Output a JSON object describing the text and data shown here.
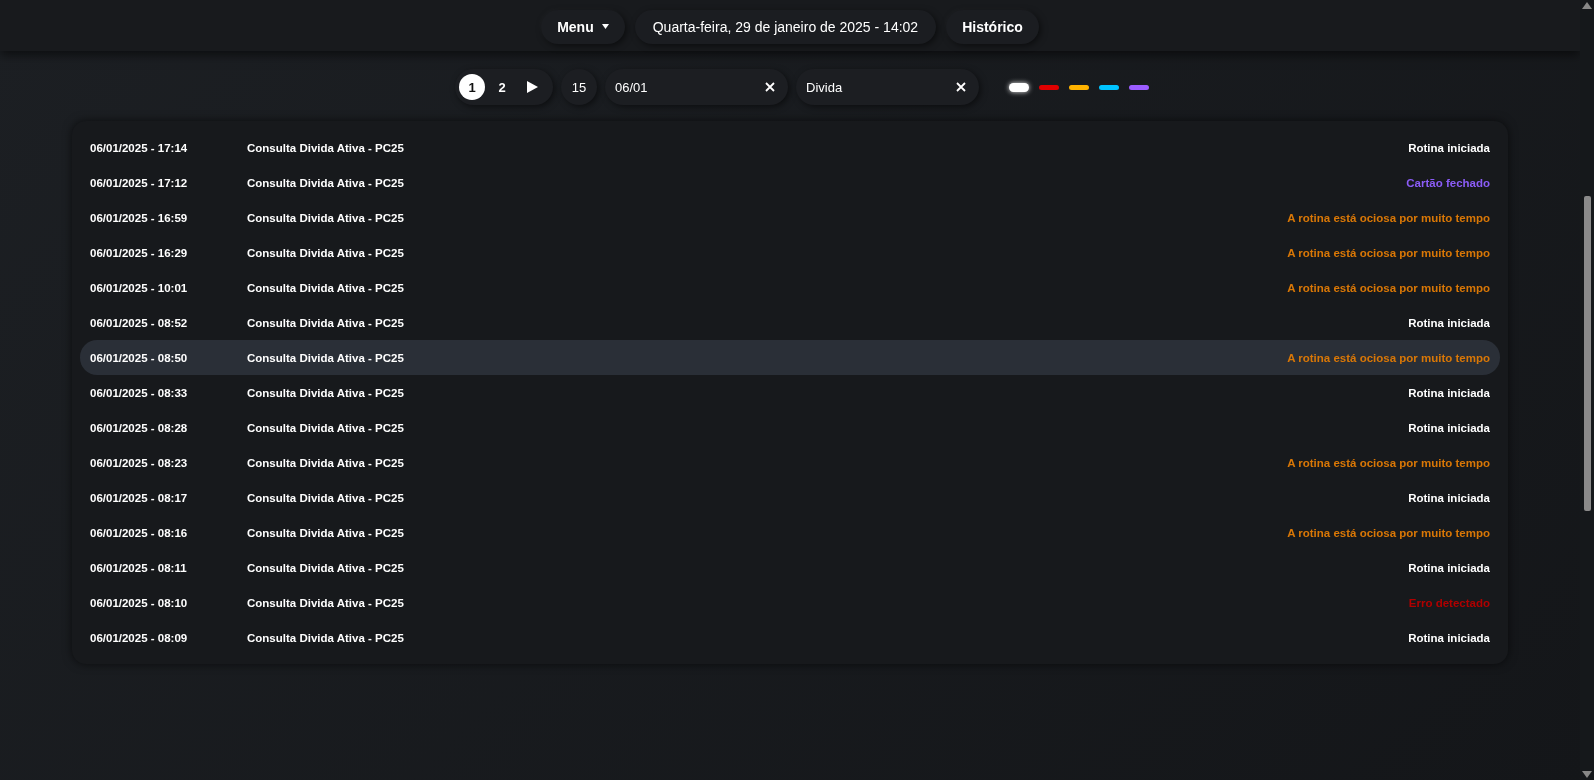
{
  "header": {
    "menu": "Menu",
    "date": "Quarta-feira, 29 de janeiro de 2025 - 14:02",
    "history": "Histórico"
  },
  "pagination": {
    "pages": [
      {
        "label": "1",
        "selected": true
      },
      {
        "label": "2",
        "selected": false
      }
    ],
    "page_size": "15"
  },
  "filters": {
    "date": {
      "value": "06/01"
    },
    "search": {
      "value": "Divida"
    }
  },
  "color_filters": [
    {
      "color": "#ffffff",
      "selected": true
    },
    {
      "color": "#e00000",
      "selected": false
    },
    {
      "color": "#ffb300",
      "selected": false
    },
    {
      "color": "#00c3ff",
      "selected": false
    },
    {
      "color": "#9b5cff",
      "selected": false
    }
  ],
  "rows": [
    {
      "time": "06/01/2025 - 17:14",
      "routine": "Consulta Divida Ativa - PC25",
      "status": "Rotina iniciada",
      "color": "#ffffff",
      "selected": false
    },
    {
      "time": "06/01/2025 - 17:12",
      "routine": "Consulta Divida Ativa - PC25",
      "status": "Cartão fechado",
      "color": "#8b5cf6",
      "selected": false
    },
    {
      "time": "06/01/2025 - 16:59",
      "routine": "Consulta Divida Ativa - PC25",
      "status": "A rotina está ociosa por muito tempo",
      "color": "#d97706",
      "selected": false
    },
    {
      "time": "06/01/2025 - 16:29",
      "routine": "Consulta Divida Ativa - PC25",
      "status": "A rotina está ociosa por muito tempo",
      "color": "#d97706",
      "selected": false
    },
    {
      "time": "06/01/2025 - 10:01",
      "routine": "Consulta Divida Ativa - PC25",
      "status": "A rotina está ociosa por muito tempo",
      "color": "#d97706",
      "selected": false
    },
    {
      "time": "06/01/2025 - 08:52",
      "routine": "Consulta Divida Ativa - PC25",
      "status": "Rotina iniciada",
      "color": "#ffffff",
      "selected": false
    },
    {
      "time": "06/01/2025 - 08:50",
      "routine": "Consulta Divida Ativa - PC25",
      "status": "A rotina está ociosa por muito tempo",
      "color": "#d97706",
      "selected": true
    },
    {
      "time": "06/01/2025 - 08:33",
      "routine": "Consulta Divida Ativa - PC25",
      "status": "Rotina iniciada",
      "color": "#ffffff",
      "selected": false
    },
    {
      "time": "06/01/2025 - 08:28",
      "routine": "Consulta Divida Ativa - PC25",
      "status": "Rotina iniciada",
      "color": "#ffffff",
      "selected": false
    },
    {
      "time": "06/01/2025 - 08:23",
      "routine": "Consulta Divida Ativa - PC25",
      "status": "A rotina está ociosa por muito tempo",
      "color": "#d97706",
      "selected": false
    },
    {
      "time": "06/01/2025 - 08:17",
      "routine": "Consulta Divida Ativa - PC25",
      "status": "Rotina iniciada",
      "color": "#ffffff",
      "selected": false
    },
    {
      "time": "06/01/2025 - 08:16",
      "routine": "Consulta Divida Ativa - PC25",
      "status": "A rotina está ociosa por muito tempo",
      "color": "#d97706",
      "selected": false
    },
    {
      "time": "06/01/2025 - 08:11",
      "routine": "Consulta Divida Ativa - PC25",
      "status": "Rotina iniciada",
      "color": "#ffffff",
      "selected": false
    },
    {
      "time": "06/01/2025 - 08:10",
      "routine": "Consulta Divida Ativa - PC25",
      "status": "Erro detectado",
      "color": "#b00000",
      "selected": false
    },
    {
      "time": "06/01/2025 - 08:09",
      "routine": "Consulta Divida Ativa - PC25",
      "status": "Rotina iniciada",
      "color": "#ffffff",
      "selected": false
    }
  ]
}
